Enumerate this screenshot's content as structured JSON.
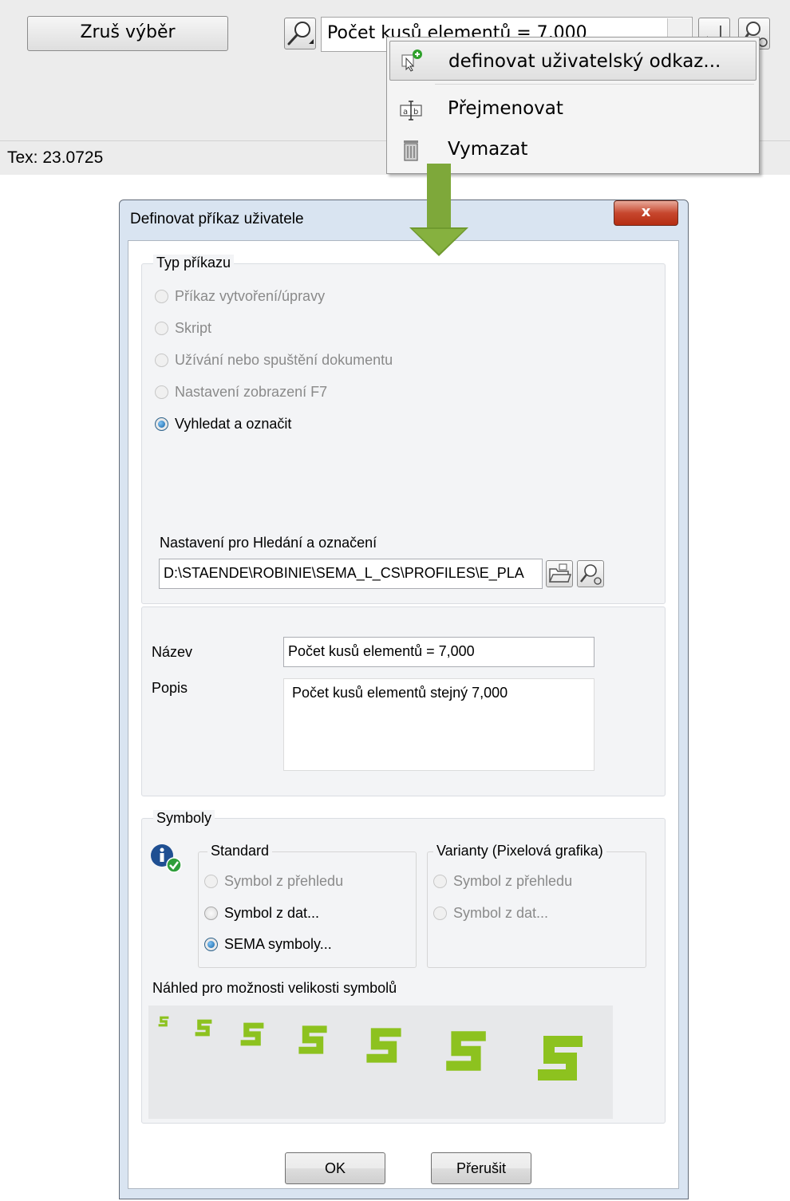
{
  "toolbar": {
    "clear_selection_label": "Zruš výběr",
    "combo_value": "Počet kusů elementů = 7,000"
  },
  "status": {
    "text": "Tex: 23.0725"
  },
  "context_menu": {
    "items": [
      {
        "label": "definovat uživatelský odkaz...",
        "icon": "define-link-icon",
        "highlighted": true
      },
      {
        "label": "Přejmenovat",
        "icon": "rename-icon"
      },
      {
        "label": "Vymazat",
        "icon": "trash-icon"
      }
    ]
  },
  "dialog": {
    "title": "Definovat příkaz uživatele",
    "close_label": "x",
    "command_type": {
      "legend": "Typ příkazu",
      "options": [
        {
          "label": "Příkaz vytvoření/úpravy",
          "enabled": false,
          "checked": false
        },
        {
          "label": "Skript",
          "enabled": false,
          "checked": false
        },
        {
          "label": "Užívání nebo spuštění dokumentu",
          "enabled": false,
          "checked": false
        },
        {
          "label": "Nastavení zobrazení F7",
          "enabled": false,
          "checked": false
        },
        {
          "label": "Vyhledat a označit",
          "enabled": true,
          "checked": true
        }
      ],
      "settings_label": "Nastavení pro Hledání a označení",
      "settings_path": "D:\\STAENDE\\ROBINIE\\SEMA_L_CS\\PROFILES\\E_PLA"
    },
    "name": {
      "label": "Název",
      "value": "Počet kusů elementů = 7,000"
    },
    "description": {
      "label": "Popis",
      "value": "Počet kusů elementů stejný 7,000"
    },
    "symbols": {
      "legend": "Symboly",
      "standard": {
        "legend": "Standard",
        "options": [
          {
            "label": "Symbol z přehledu",
            "enabled": false,
            "checked": false
          },
          {
            "label": "Symbol z dat...",
            "enabled": true,
            "checked": false
          },
          {
            "label": "SEMA symboly...",
            "enabled": true,
            "checked": true
          }
        ]
      },
      "variants": {
        "legend": "Varianty (Pixelová grafika)",
        "options": [
          {
            "label": "Symbol z přehledu",
            "enabled": false,
            "checked": false
          },
          {
            "label": "Symbol z dat...",
            "enabled": false,
            "checked": false
          }
        ]
      },
      "preview_label": "Náhled pro možnosti velikosti symbolů",
      "preview_symbol": "S",
      "preview_color": "#8dc21f"
    },
    "buttons": {
      "ok": "OK",
      "cancel": "Přerušit"
    }
  },
  "colors": {
    "arrow": "#7ea83a",
    "dialog_frame": "#d9e4f1",
    "close_button": "#c7472e"
  }
}
